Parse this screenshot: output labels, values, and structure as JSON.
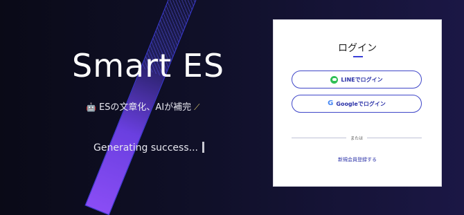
{
  "hero": {
    "title": "Smart ES",
    "subtitle": "ESの文章化、AIが補完",
    "subtitle_icon_left": "robot-icon",
    "subtitle_icon_right": "magic-wand-icon",
    "typing_text": "Generating success..."
  },
  "login_card": {
    "title": "ログイン",
    "line_button_label": "LINEでログイン",
    "google_button_label": "Googleでログイン",
    "divider_text": "または",
    "register_link": "新規会員登録する"
  },
  "colors": {
    "accent": "#3a3fd8",
    "line_green": "#2fbf55",
    "stripe_purple": "#8a4df5"
  }
}
